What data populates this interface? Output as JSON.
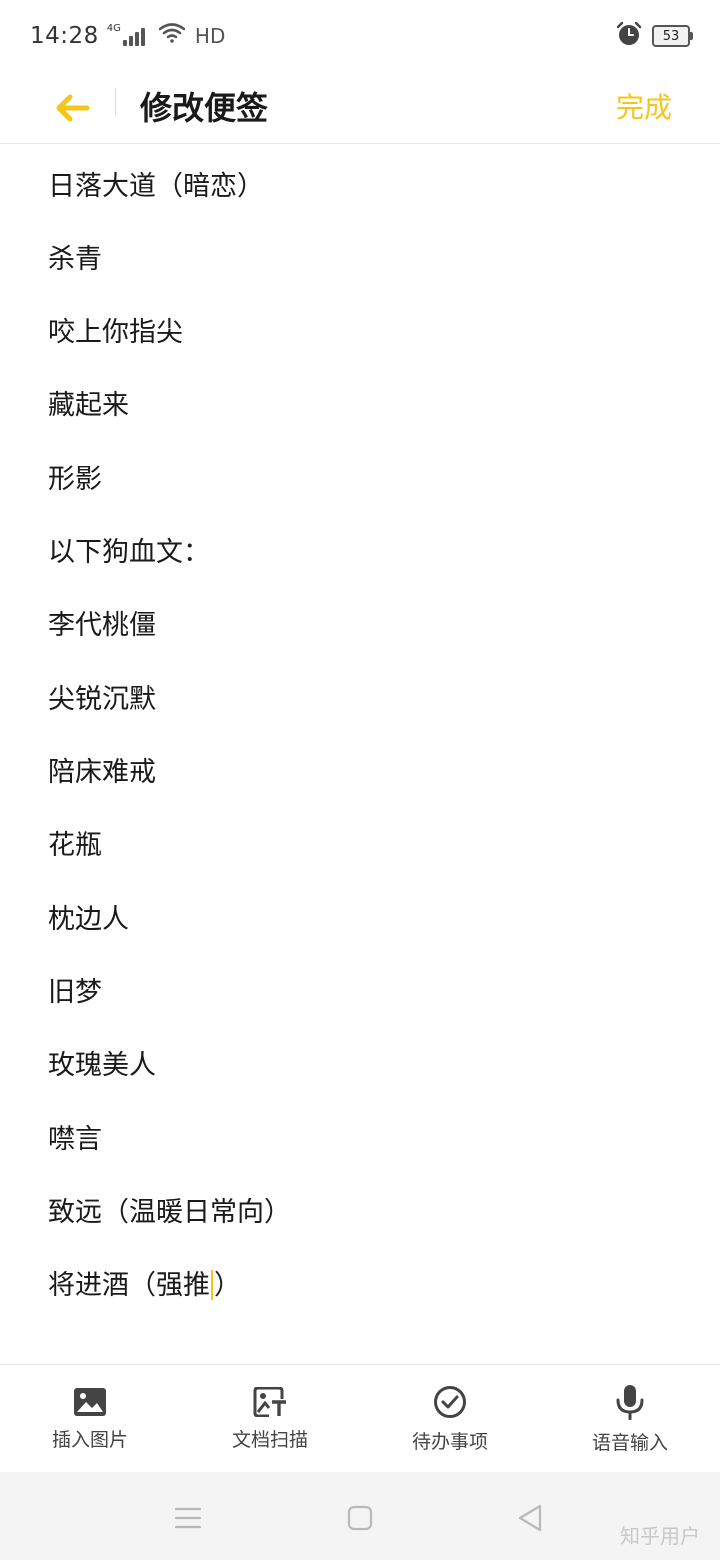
{
  "status_bar": {
    "time": "14:28",
    "network_type": "4G",
    "hd_label": "HD",
    "battery_level": "53"
  },
  "header": {
    "title": "修改便签",
    "done_label": "完成"
  },
  "note": {
    "lines": [
      "日落大道（暗恋）",
      "杀青",
      "咬上你指尖",
      "藏起来",
      "形影",
      "以下狗血文：",
      "李代桃僵",
      "尖锐沉默",
      "陪床难戒",
      "花瓶",
      "枕边人",
      "旧梦",
      "玫瑰美人",
      "噤言",
      "致远（温暖日常向）"
    ],
    "last_line_before_cursor": "将进酒（强推",
    "last_line_after_cursor": "）"
  },
  "toolbar": {
    "insert_image_label": "插入图片",
    "scan_document_label": "文档扫描",
    "todo_label": "待办事项",
    "voice_input_label": "语音输入"
  },
  "watermark": "知乎用户",
  "colors": {
    "accent": "#f5c518",
    "text": "#1a1a1a",
    "nav_bg": "#f4f4f4"
  }
}
